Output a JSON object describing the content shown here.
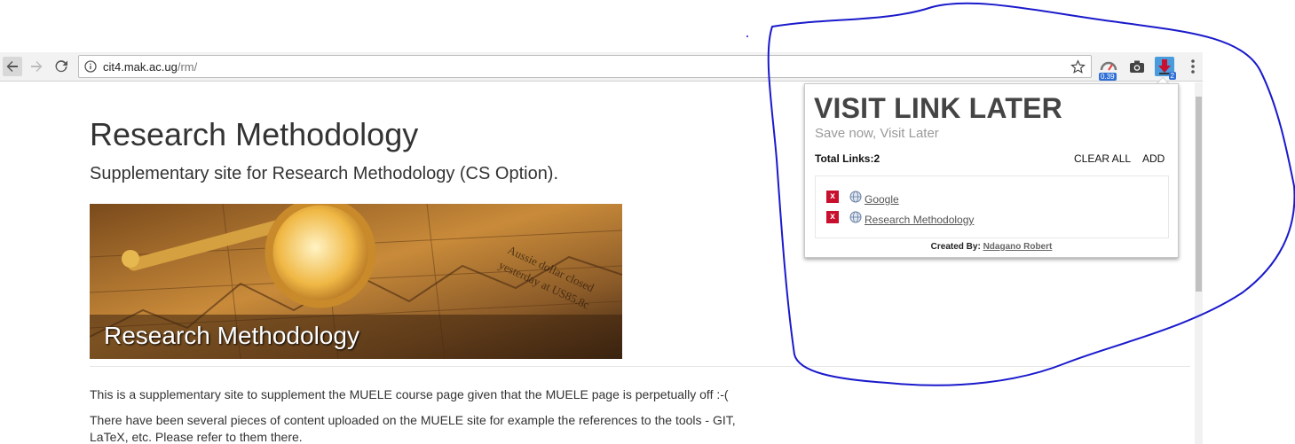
{
  "browser": {
    "url_host": "cit4.mak.ac.ug",
    "url_path": "/rm/",
    "extensions": {
      "gauge_badge": "0.39",
      "vll_badge": "2"
    }
  },
  "page": {
    "title": "Research Methodology",
    "subtitle": "Supplementary site for Research Methodology (CS Option).",
    "banner_caption": "Research Methodology",
    "paragraph1": "This is a supplementary site to supplement the MUELE course page given that the MUELE page is perpetually off :-(",
    "paragraph2": "There have been several pieces of content uploaded on the MUELE site for example the references to the tools - GIT, LaTeX, etc. Please refer to them there."
  },
  "popup": {
    "title": "VISIT LINK LATER",
    "subtitle": "Save now, Visit Later",
    "total_label": "Total Links:2",
    "clear_all": "CLEAR ALL",
    "add": "ADD",
    "links": [
      {
        "delete_label": "x",
        "label": " Google"
      },
      {
        "delete_label": "x",
        "label": " Research Methodology"
      }
    ],
    "footer_prefix": "Created By: ",
    "footer_author": "Ndagano Robert"
  },
  "colors": {
    "annotation": "#1a1acc",
    "delete_button": "#c8102e"
  }
}
